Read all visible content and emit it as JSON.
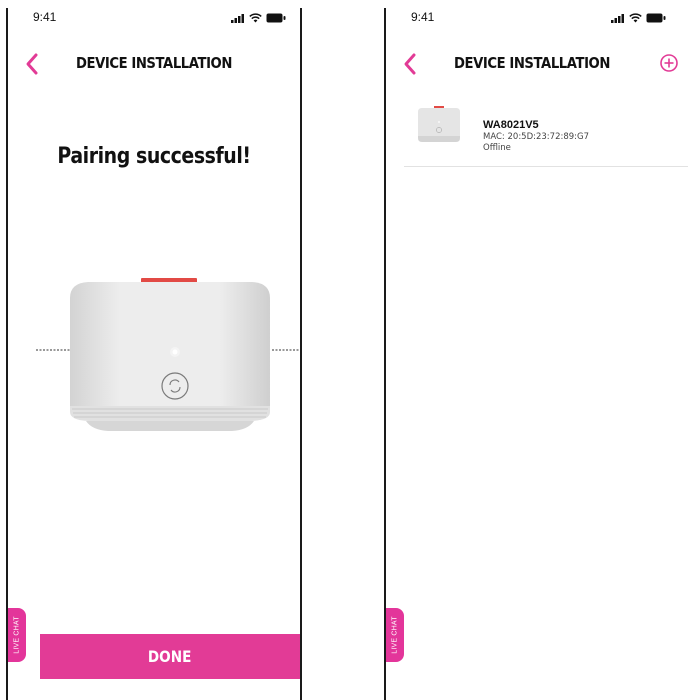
{
  "colors": {
    "accent": "#e23b96",
    "text": "#111111",
    "divider": "#e2e2e2"
  },
  "screens": {
    "pairing": {
      "status_time": "9:41",
      "title": "DEVICE INSTALLATION",
      "message": "Pairing successful!",
      "live_chat_label": "LIVE CHAT",
      "done_label": "DONE",
      "icons": {
        "back": "chevron-left-icon",
        "signal": "signal-icon",
        "wifi": "wifi-icon",
        "battery": "battery-icon"
      }
    },
    "device_list": {
      "status_time": "9:41",
      "title": "DEVICE INSTALLATION",
      "live_chat_label": "LIVE CHAT",
      "devices": [
        {
          "name": "WA8021V5",
          "mac": "MAC: 20:5D:23:72:89:G7",
          "status": "Offline"
        }
      ],
      "icons": {
        "back": "chevron-left-icon",
        "add": "plus-circle-icon"
      }
    }
  }
}
